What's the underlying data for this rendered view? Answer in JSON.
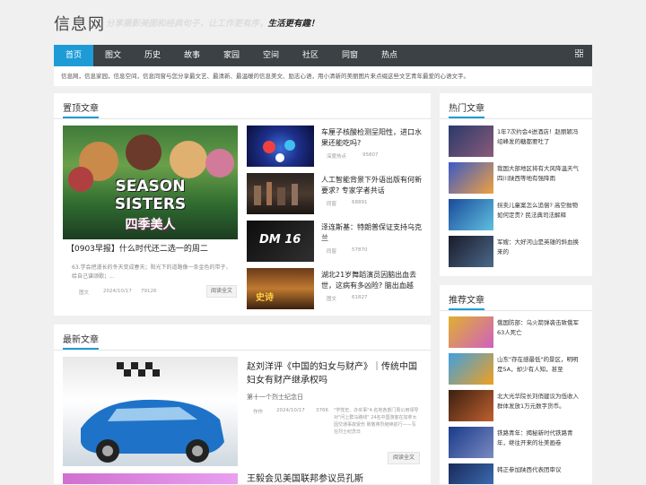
{
  "header": {
    "logo": "信息网",
    "slogan_faded": "分享摄影美图和经典句子，让工作更有序，",
    "slogan": "生活更有趣！"
  },
  "nav": {
    "items": [
      "首页",
      "图文",
      "历史",
      "故事",
      "家园",
      "空间",
      "社区",
      "同窗",
      "热点"
    ],
    "active_index": 0,
    "menu_icon": "grid-icon"
  },
  "intro": "信息网，信息家园，信息空间，信息同窗与您分享最文艺、最清新、最温暖的信息美文、励志心语，用小清新的美丽图片来点缀这些文艺青年最爱的心语文字。",
  "featured": {
    "title": "置顶文章",
    "main": {
      "image_text_1": "SEASON",
      "image_text_2": "SISTERS",
      "image_text_3": "四季美人",
      "headline": "【0903早报】什么时代还二选一的周二",
      "summary": "63.学会把漫长的冬天变成春天；阳光下的道路像一条金色的带子，给自己谱颂歌；...",
      "category": "图文",
      "date": "2024/10/17",
      "views": "79126",
      "read_more": "阅读全文"
    },
    "items": [
      {
        "title": "车厘子核酸检测呈阳性，进口水果还能吃吗?",
        "category": "深度热点",
        "views": "95807"
      },
      {
        "title": "人工智能背景下外语出版有何新要求? 专家学者共话",
        "category": "同窗",
        "views": "68891"
      },
      {
        "title": "泽连斯基：特朗普保证支持乌克兰",
        "category": "同窗",
        "views": "57870"
      },
      {
        "title": "湖北21岁舞蹈演员因脑出血去世，这病有多凶险? 脑出血越",
        "category": "图文",
        "views": "61827"
      }
    ]
  },
  "latest": {
    "title": "最新文章",
    "article": {
      "headline": "赵刘洋评《中国的妇女与财产》｜传统中国妇女有财产继承权吗",
      "subtitle": "第十一个烈士纪念日",
      "author": "作作",
      "date": "2024/10/17",
      "views": "3766",
      "excerpt": "\"学党史、办实事\"4·名地各部门周公用领导对\"问上群马路线\" 24名中国游客在加拿大因交通事故受伤 致敬英烈继续前行——写在烈士纪念日",
      "read_more": "阅读全文"
    },
    "next_headline": "王毅会见美国联邦参议员孔斯"
  },
  "hot": {
    "title": "热门文章",
    "items": [
      "1年7次约会4进酒店！赵丽颖冯绍峰发的糖都要吐了",
      "我国大部地区将有大风降温天气 四川陕西等地有强降雨",
      "拐卖儿童案怎么追偿? 高空抛物如何定责? 民法典司法解释",
      "军嫂：大好河山是英雄的斜血换来的"
    ]
  },
  "recommend": {
    "title": "推荐文章",
    "items": [
      "俄国防部：乌火箭弹袭击致俄军63人死亡",
      "山东\"存在感最低\"的景区，明明是5A，却少有人知，甚至",
      "北大光华院长刘俏建议为低收入群体发放1万元数字货币。",
      "铁路青年：揭秘新时代铁路青年，继往开来的壮美画卷",
      "韩正参加陕西代表团审议"
    ]
  },
  "colors": {
    "accent": "#1e9bd7",
    "nav_bg": "#3b4144",
    "page_bg": "#f0f0f0"
  }
}
